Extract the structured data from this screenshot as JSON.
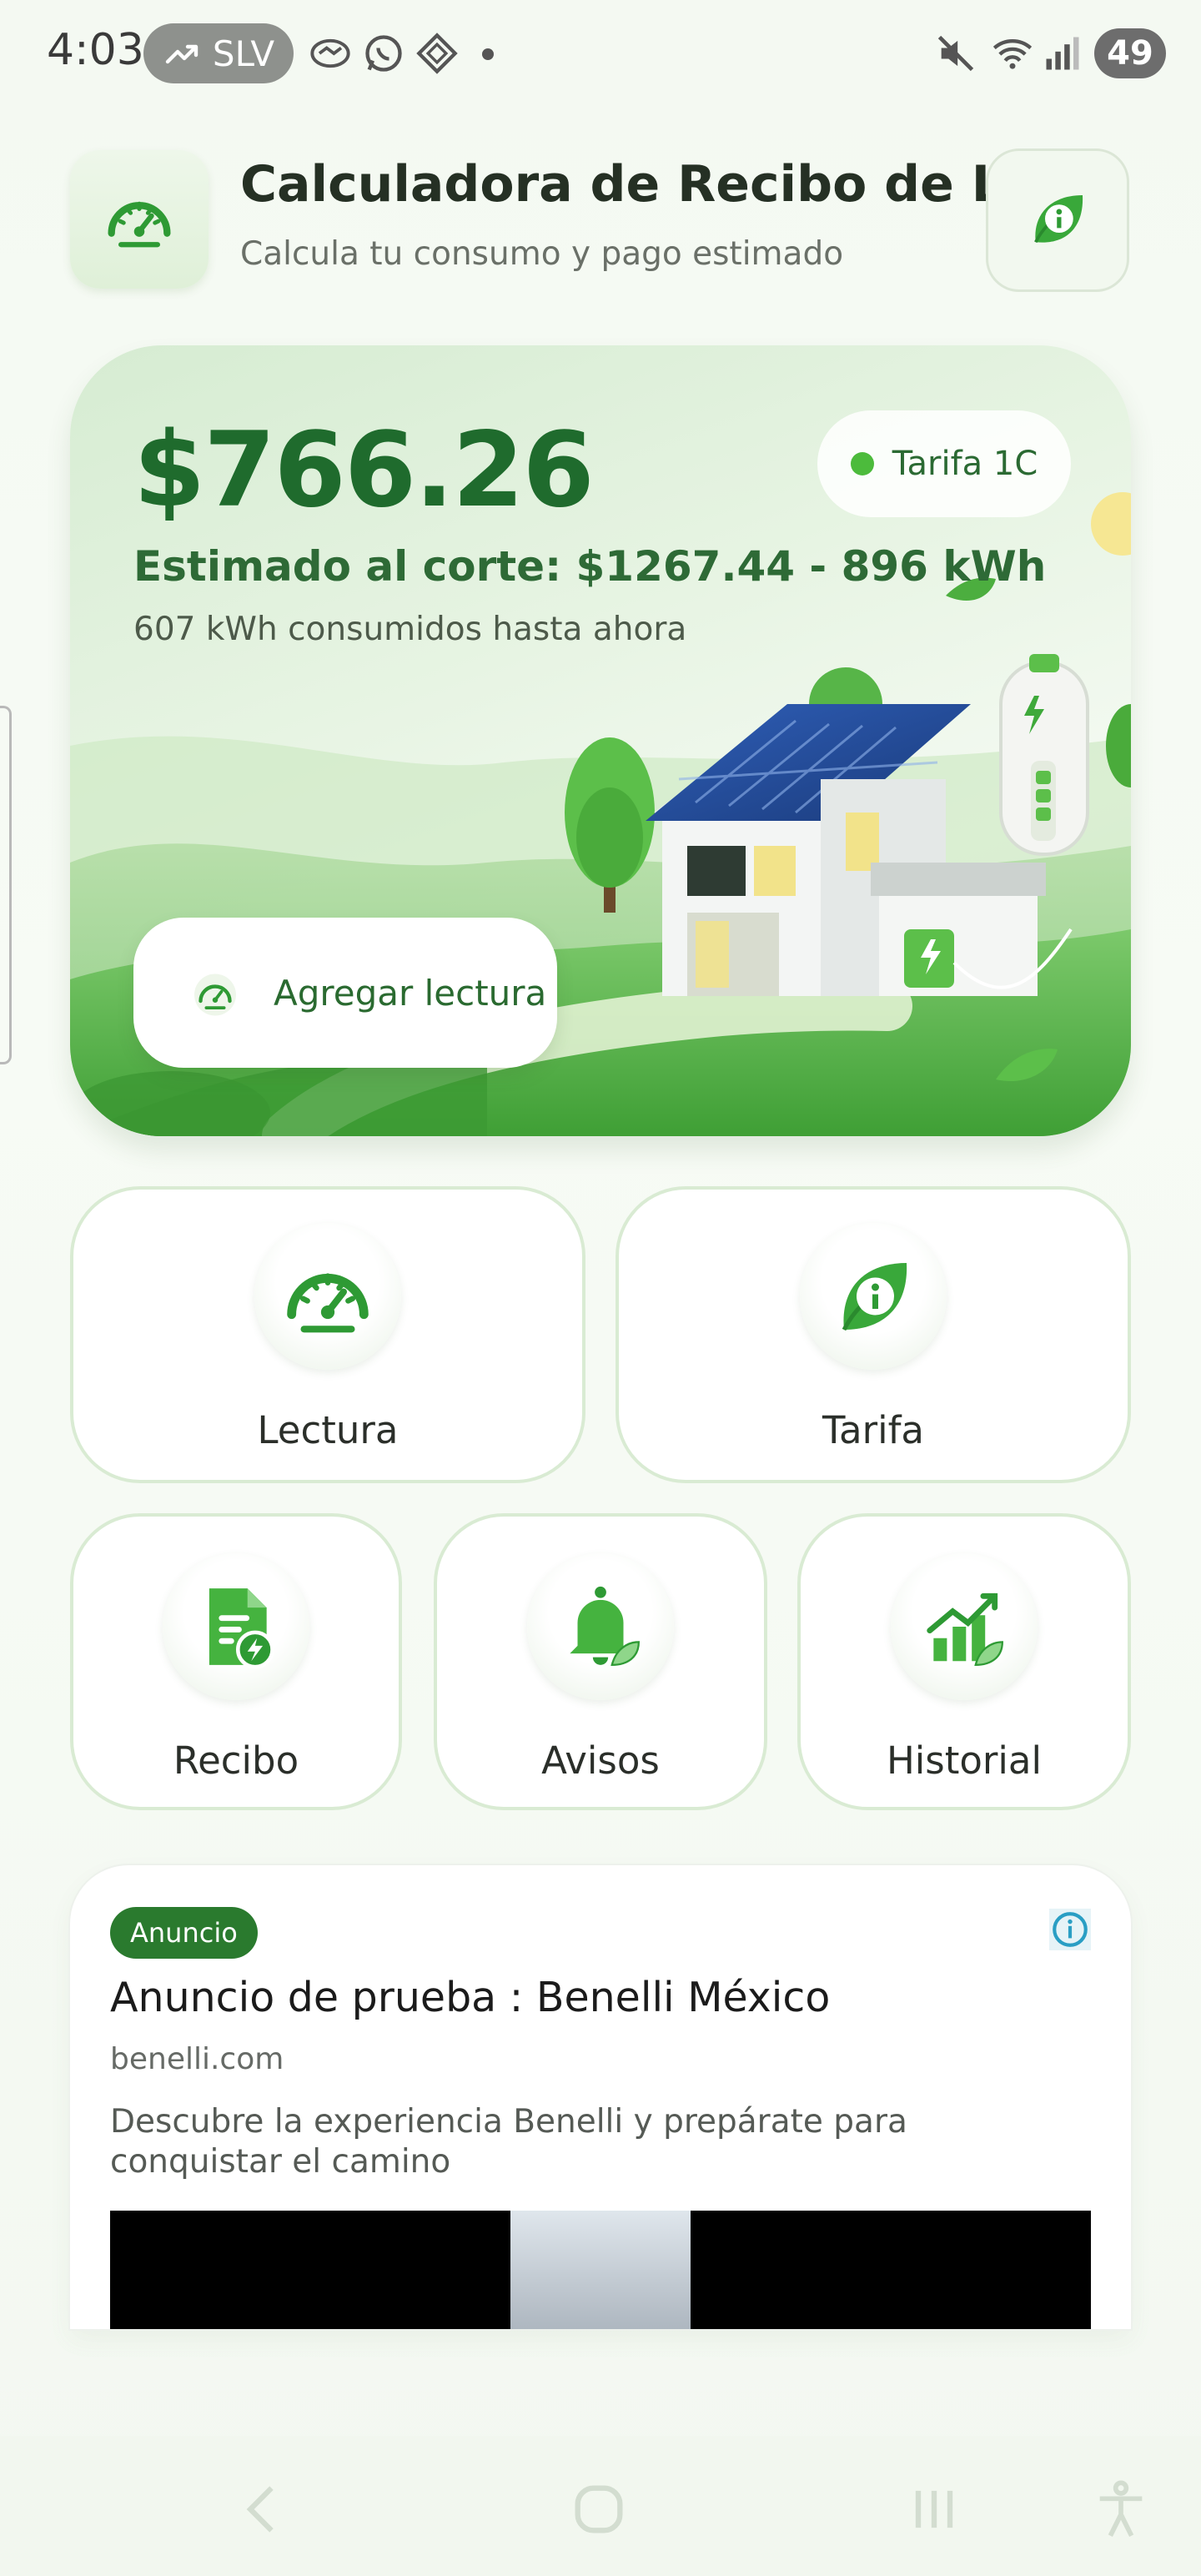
{
  "status_bar": {
    "time": "4:03",
    "ticker": "SLV",
    "battery": "49"
  },
  "header": {
    "title": "Calculadora de Recibo de Luz",
    "subtitle": "Calcula tu consumo y pago estimado",
    "logo_icon": "speedometer-icon",
    "info_icon": "leaf-info-icon"
  },
  "hero": {
    "amount": "$766.26",
    "estimate": "Estimado al corte: $1267.44 - 896 kWh",
    "consumed": "607 kWh consumidos hasta ahora",
    "tariff": "Tarifa 1C",
    "add_reading": "Agregar lectura"
  },
  "actions": {
    "row1": [
      {
        "label": "Lectura",
        "icon": "speedometer-icon"
      },
      {
        "label": "Tarifa",
        "icon": "leaf-info-icon"
      }
    ],
    "row2": [
      {
        "label": "Recibo",
        "icon": "document-bolt-icon"
      },
      {
        "label": "Avisos",
        "icon": "bell-icon"
      },
      {
        "label": "Historial",
        "icon": "growth-chart-icon"
      }
    ]
  },
  "ad": {
    "badge": "Anuncio",
    "title": "Anuncio de prueba : Benelli México",
    "domain": "benelli.com",
    "description": "Descubre la experiencia Benelli y prepárate para conquistar el camino"
  },
  "colors": {
    "accent": "#2a7a2e",
    "primary_text": "#1f6b2d",
    "card_border": "#d9ebd3"
  }
}
